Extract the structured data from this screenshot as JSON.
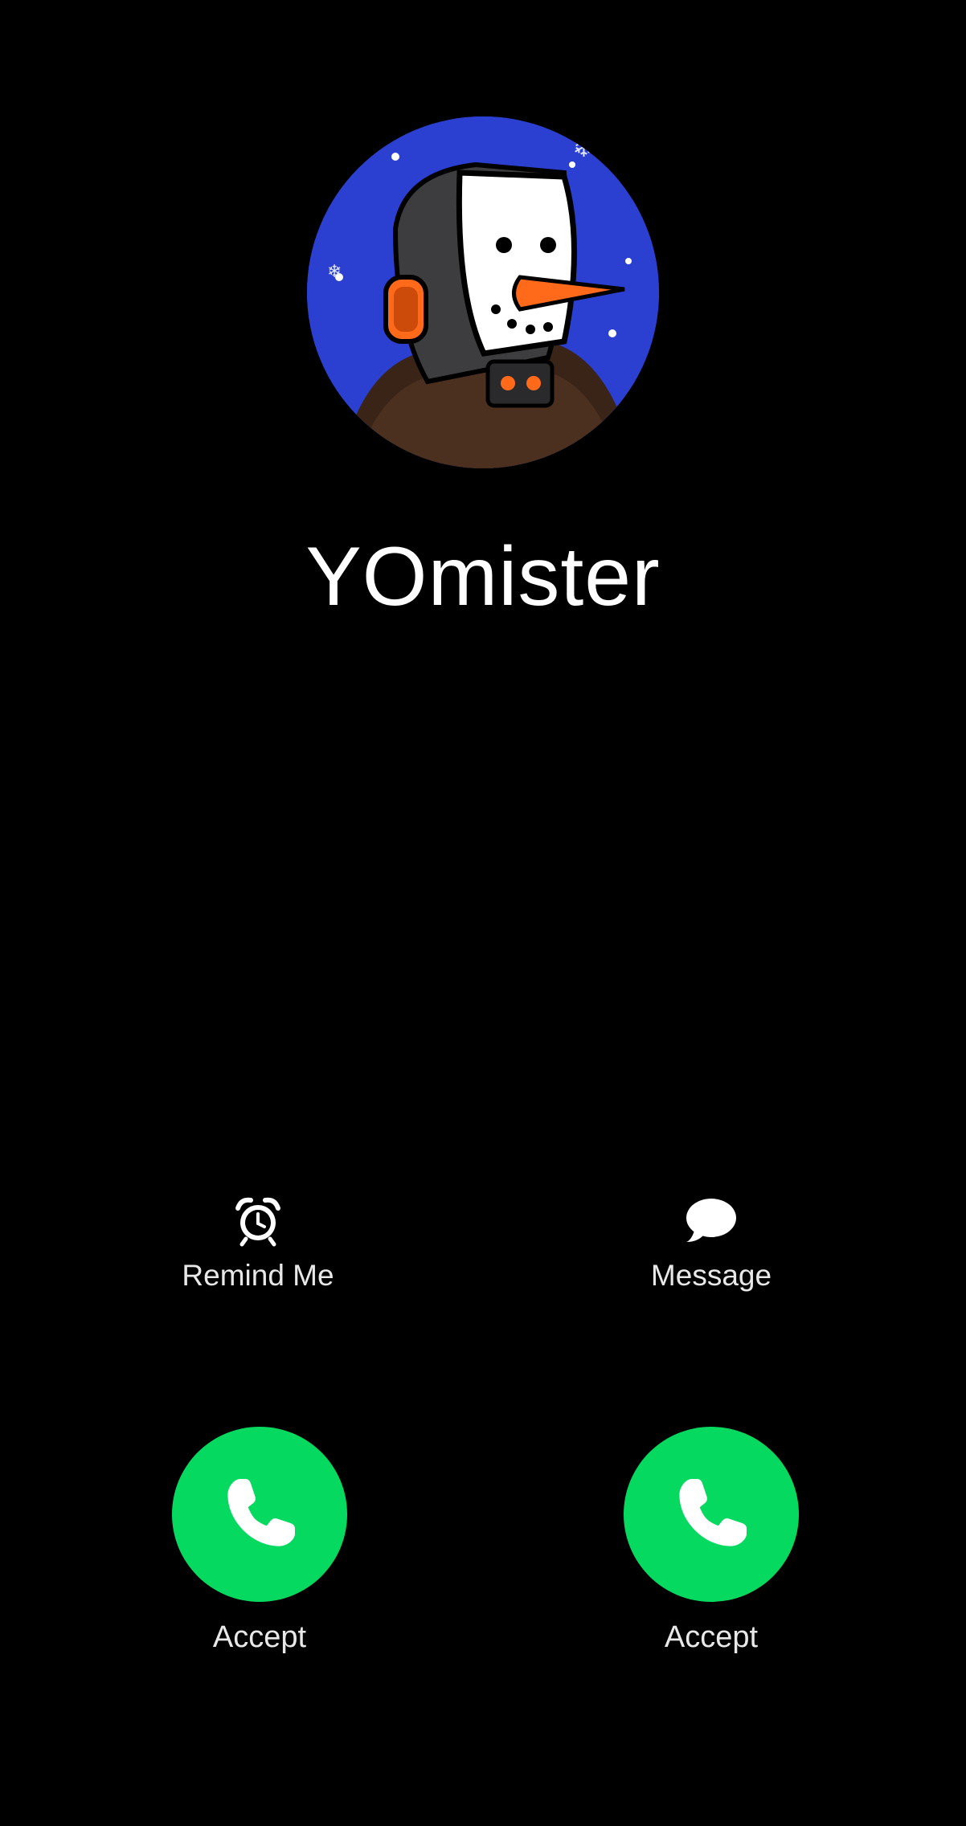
{
  "caller": {
    "name": "YOmister",
    "avatar": "snowman-robot-avatar"
  },
  "actions": {
    "remind": {
      "label": "Remind Me",
      "icon": "alarm-clock-icon"
    },
    "message": {
      "label": "Message",
      "icon": "speech-bubble-icon"
    }
  },
  "buttons": {
    "accept_left": {
      "label": "Accept",
      "icon": "phone-icon"
    },
    "accept_right": {
      "label": "Accept",
      "icon": "phone-icon"
    }
  },
  "colors": {
    "background": "#000000",
    "accept": "#06d95f",
    "avatar_background": "#2b3fd1",
    "text": "#ffffff"
  }
}
